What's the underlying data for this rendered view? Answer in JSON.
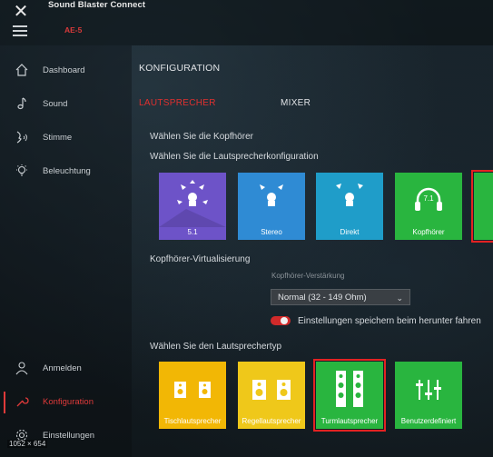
{
  "window": {
    "title": "Sound Blaster Connect",
    "device": "AE-5",
    "close_icon": "x-close-icon",
    "menu_icon": "hamburger-icon"
  },
  "sidebar": {
    "items": [
      {
        "label": "Dashboard",
        "icon": "home-icon"
      },
      {
        "label": "Sound",
        "icon": "music-note-icon"
      },
      {
        "label": "Stimme",
        "icon": "voice-icon"
      },
      {
        "label": "Beleuchtung",
        "icon": "lightbulb-icon"
      },
      {
        "label": "Anmelden",
        "icon": "user-icon"
      },
      {
        "label": "Konfiguration",
        "icon": "wrench-icon",
        "active": true
      },
      {
        "label": "Einstellungen",
        "icon": "gear-icon"
      }
    ]
  },
  "main": {
    "section_title": "KONFIGURATION",
    "tabs": [
      {
        "label": "LAUTSPRECHER",
        "active": true
      },
      {
        "label": "MIXER",
        "active": false
      }
    ],
    "headphone_label": "Wählen Sie die Kopfhörer",
    "speaker_config_label": "Wählen Sie die Lautsprecherkonfiguration",
    "config_tiles": [
      {
        "name": "5.1",
        "color": "#6d53c8"
      },
      {
        "name": "Stereo",
        "color": "#2f8bd4"
      },
      {
        "name": "Direkt",
        "color": "#1f9dc9"
      },
      {
        "name": "Kopfhörer",
        "color": "#29b53f"
      },
      {
        "name": "",
        "color": "#29b53f",
        "selected": true
      }
    ],
    "virtualization_label": "Kopfhörer-Virtualisierung",
    "amp_label": "Kopfhörer-Verstärkung",
    "amp_value": "Normal (32 - 149 Ohm)",
    "save_toggle_label": "Einstellungen speichern beim herunter fahren",
    "speaker_type_label": "Wählen Sie den Lautsprechertyp",
    "type_tiles": [
      {
        "name": "Tischlautsprecher",
        "color": "#f2b705"
      },
      {
        "name": "Regellautsprecher",
        "color": "#efc81a"
      },
      {
        "name": "Turmlautsprecher",
        "color": "#29b53f",
        "selected": true
      },
      {
        "name": "Benutzerdefiniert",
        "color": "#29b53f"
      }
    ]
  },
  "overlay": {
    "dimensions": "1052 × 654"
  }
}
